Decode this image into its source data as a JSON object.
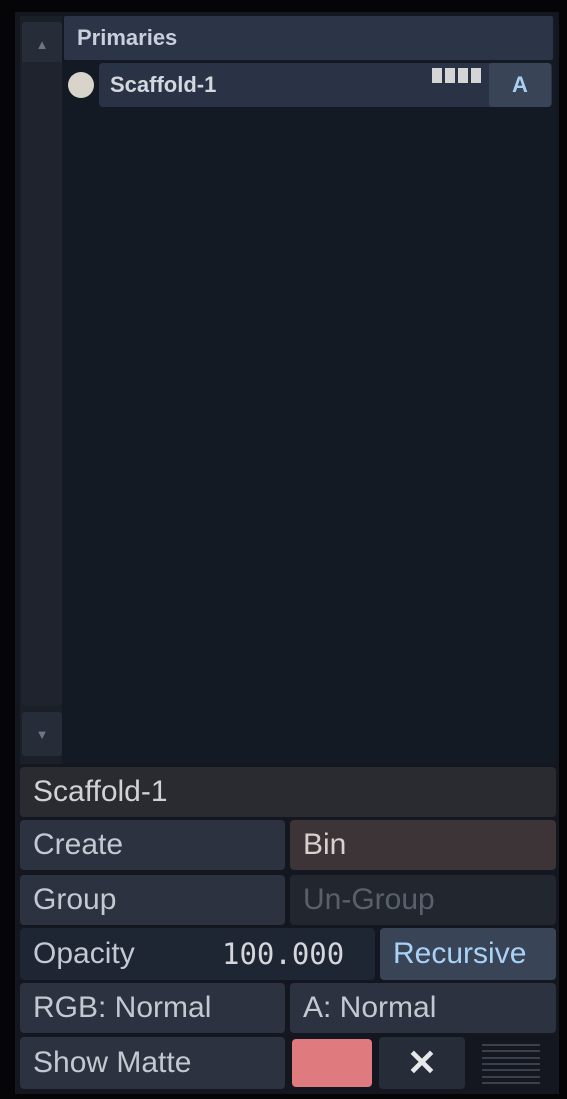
{
  "layers": {
    "header": "Primaries",
    "items": [
      {
        "label": "Scaffold-1",
        "channel_button": "A"
      }
    ]
  },
  "controls": {
    "name_field_value": "Scaffold-1",
    "create_label": "Create",
    "bin_label": "Bin",
    "group_label": "Group",
    "ungroup_label": "Un-Group",
    "opacity_label": "Opacity",
    "opacity_value": "100.000",
    "recursive_label": "Recursive",
    "rgb_mode": "RGB: Normal",
    "alpha_mode": "A: Normal",
    "show_matte_label": "Show Matte",
    "matte_color": "#df7a7e",
    "close_glyph": "✕"
  },
  "icons": {
    "scroll_up": "triangle-up-icon",
    "scroll_down": "triangle-down-icon",
    "menu": "hamburger-icon"
  }
}
